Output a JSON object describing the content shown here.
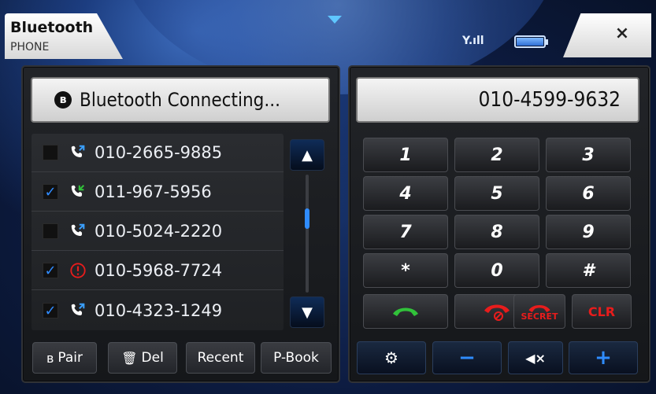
{
  "header": {
    "title": "Bluetooth",
    "subtitle": "PHONE",
    "close_icon": "×",
    "signal_text": "Y.ıll"
  },
  "status": {
    "bluetooth_icon": "ʙ",
    "text": "Bluetooth Connecting..."
  },
  "dial_display": {
    "number": "010-4599-9632"
  },
  "call_list": [
    {
      "checked": false,
      "checkmark": "",
      "type": "outgoing",
      "number": "010-2665-9885"
    },
    {
      "checked": true,
      "checkmark": "✓",
      "type": "incoming",
      "number": "011-967-5956"
    },
    {
      "checked": false,
      "checkmark": "",
      "type": "outgoing",
      "number": "010-5024-2220"
    },
    {
      "checked": true,
      "checkmark": "✓",
      "type": "missed",
      "number": "010-5968-7724"
    },
    {
      "checked": true,
      "checkmark": "✓",
      "type": "outgoing",
      "number": "010-4323-1249"
    }
  ],
  "scroll": {
    "up_symbol": "▲",
    "down_symbol": "▼"
  },
  "left_buttons": {
    "pair_symbol": "ʙ",
    "pair": "Pair",
    "del_symbol": "🗑",
    "del": "Del",
    "recent": "Recent",
    "pbook": "P-Book"
  },
  "keypad": [
    "1",
    "2",
    "3",
    "4",
    "5",
    "6",
    "7",
    "8",
    "9",
    "*",
    "0",
    "#"
  ],
  "function_keys": {
    "secret": "SECRET",
    "clr": "CLR"
  },
  "controls": {
    "settings_symbol": "⚙",
    "minus_symbol": "−",
    "mute_symbol": "◀×",
    "plus_symbol": "+"
  },
  "colors": {
    "accent_blue": "#2f8cff",
    "call_green": "#31c23a",
    "end_red": "#e81c1c"
  }
}
